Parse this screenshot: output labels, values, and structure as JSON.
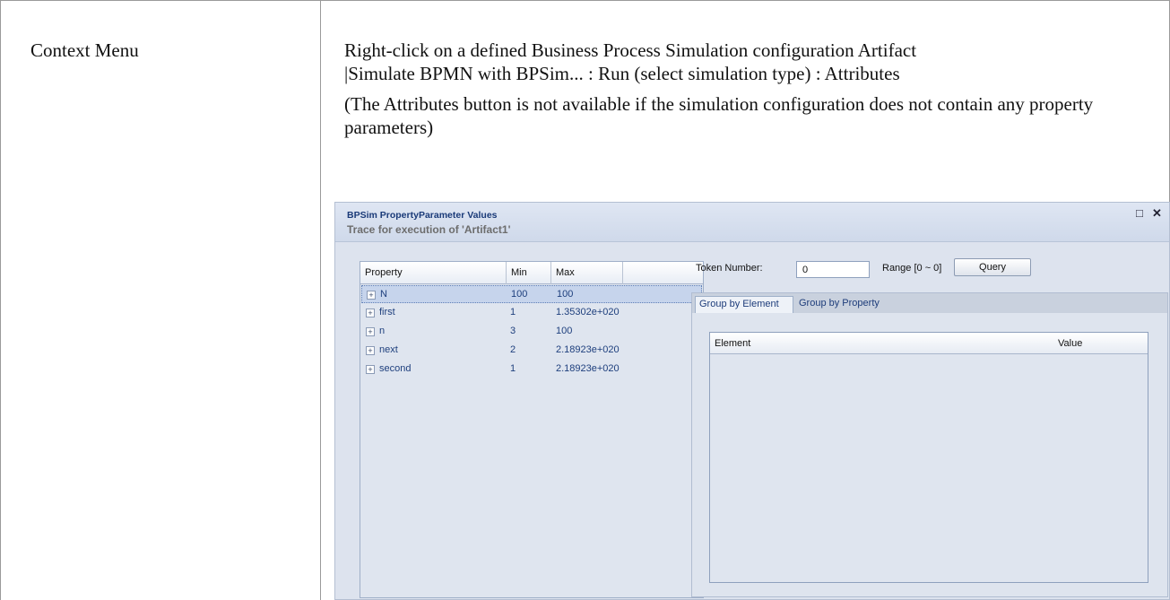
{
  "doc": {
    "label": "Context Menu",
    "line1": "Right-click on a defined Business Process Simulation configuration Artifact",
    "line2": "|Simulate BPMN with BPSim... : Run (select simulation type) : Attributes",
    "note": "(The Attributes button is not available if the simulation configuration does not contain any property parameters)"
  },
  "window": {
    "title": "BPSim PropertyParameter Values",
    "trace": "Trace for execution of 'Artifact1'",
    "max_icon": "maximize-icon",
    "close_icon": "close-icon"
  },
  "properties": {
    "columns": [
      "Property",
      "Min",
      "Max"
    ],
    "rows": [
      {
        "name": "N",
        "min": "100",
        "max": "100"
      },
      {
        "name": "first",
        "min": "1",
        "max": "1.35302e+020"
      },
      {
        "name": "n",
        "min": "3",
        "max": "100"
      },
      {
        "name": "next",
        "min": "2",
        "max": "2.18923e+020"
      },
      {
        "name": "second",
        "min": "1",
        "max": "2.18923e+020"
      }
    ],
    "selected_index": 0
  },
  "query": {
    "token_label": "Token Number:",
    "token_value": "0",
    "range_label": "Range [0 ~ 0]",
    "button_label": "Query"
  },
  "tabs": {
    "active": "Group by Element",
    "inactive": "Group by Property"
  },
  "element_grid": {
    "columns": [
      "Element",
      "Value"
    ]
  },
  "colors": {
    "window_bg": "#dde3ee",
    "title_text": "#1a3a78",
    "row_text": "#1e3f7d",
    "selection": "#c6d4ec"
  }
}
